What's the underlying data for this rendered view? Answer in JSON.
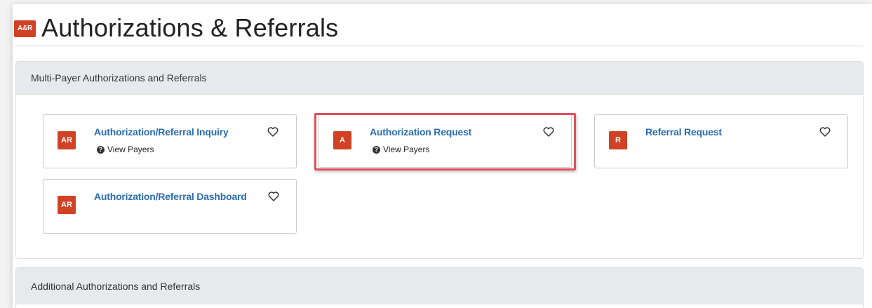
{
  "header": {
    "logo_text": "A&R",
    "title": "Authorizations & Referrals"
  },
  "sections": [
    {
      "title": "Multi-Payer Authorizations and Referrals",
      "cards": [
        {
          "icon": "AR",
          "title": "Authorization/Referral Inquiry",
          "sub": "View Payers",
          "favorite": false
        },
        {
          "icon": "A",
          "title": "Authorization Request",
          "sub": "View Payers",
          "favorite": false,
          "highlighted": true
        },
        {
          "icon": "R",
          "title": "Referral Request",
          "sub": "",
          "favorite": false
        },
        {
          "icon": "AR",
          "title": "Authorization/Referral Dashboard",
          "sub": "",
          "favorite": false
        }
      ]
    },
    {
      "title": "Additional Authorizations and Referrals",
      "cards": []
    }
  ],
  "colors": {
    "brand": "#d14124",
    "link": "#2a6db3",
    "highlight": "#e0515b",
    "section_header_bg": "#e7eaec"
  },
  "icons": {
    "favorite": "heart-outline-icon",
    "help": "question-circle-icon"
  }
}
